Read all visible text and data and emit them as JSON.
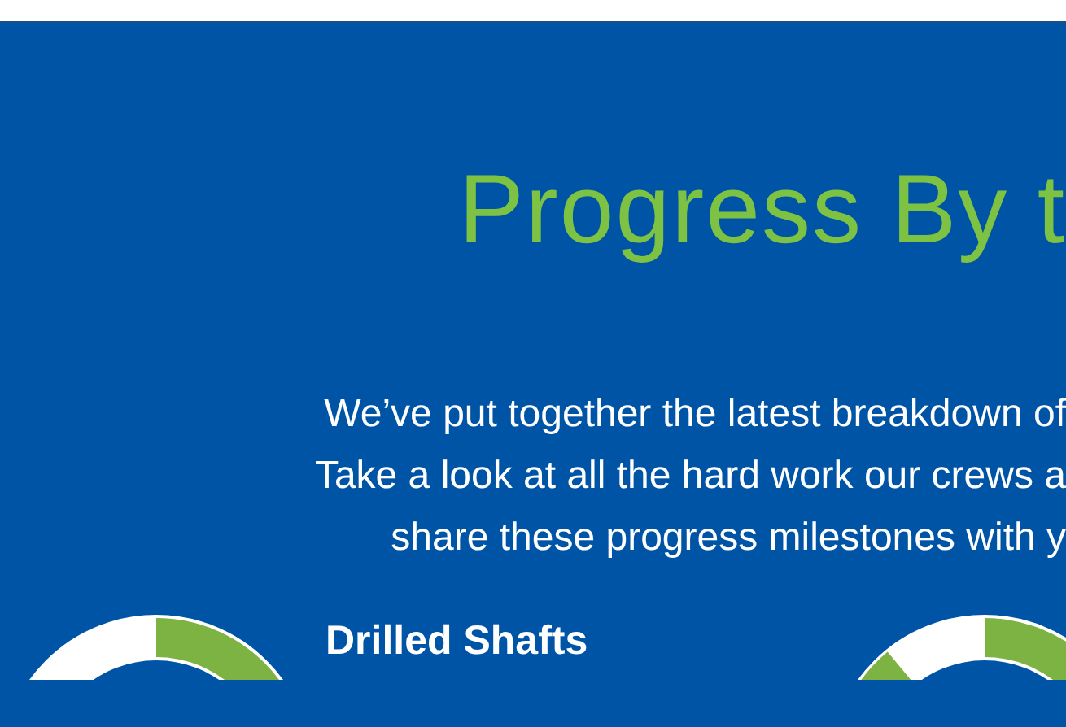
{
  "heading": "Progress By t",
  "intro_lines": [
    "We’ve put together the latest breakdown of",
    "Take a look at all the hard work our crews a",
    "share these progress milestones with y"
  ],
  "milestones": [
    {
      "title": "Drilled Shafts"
    }
  ]
}
